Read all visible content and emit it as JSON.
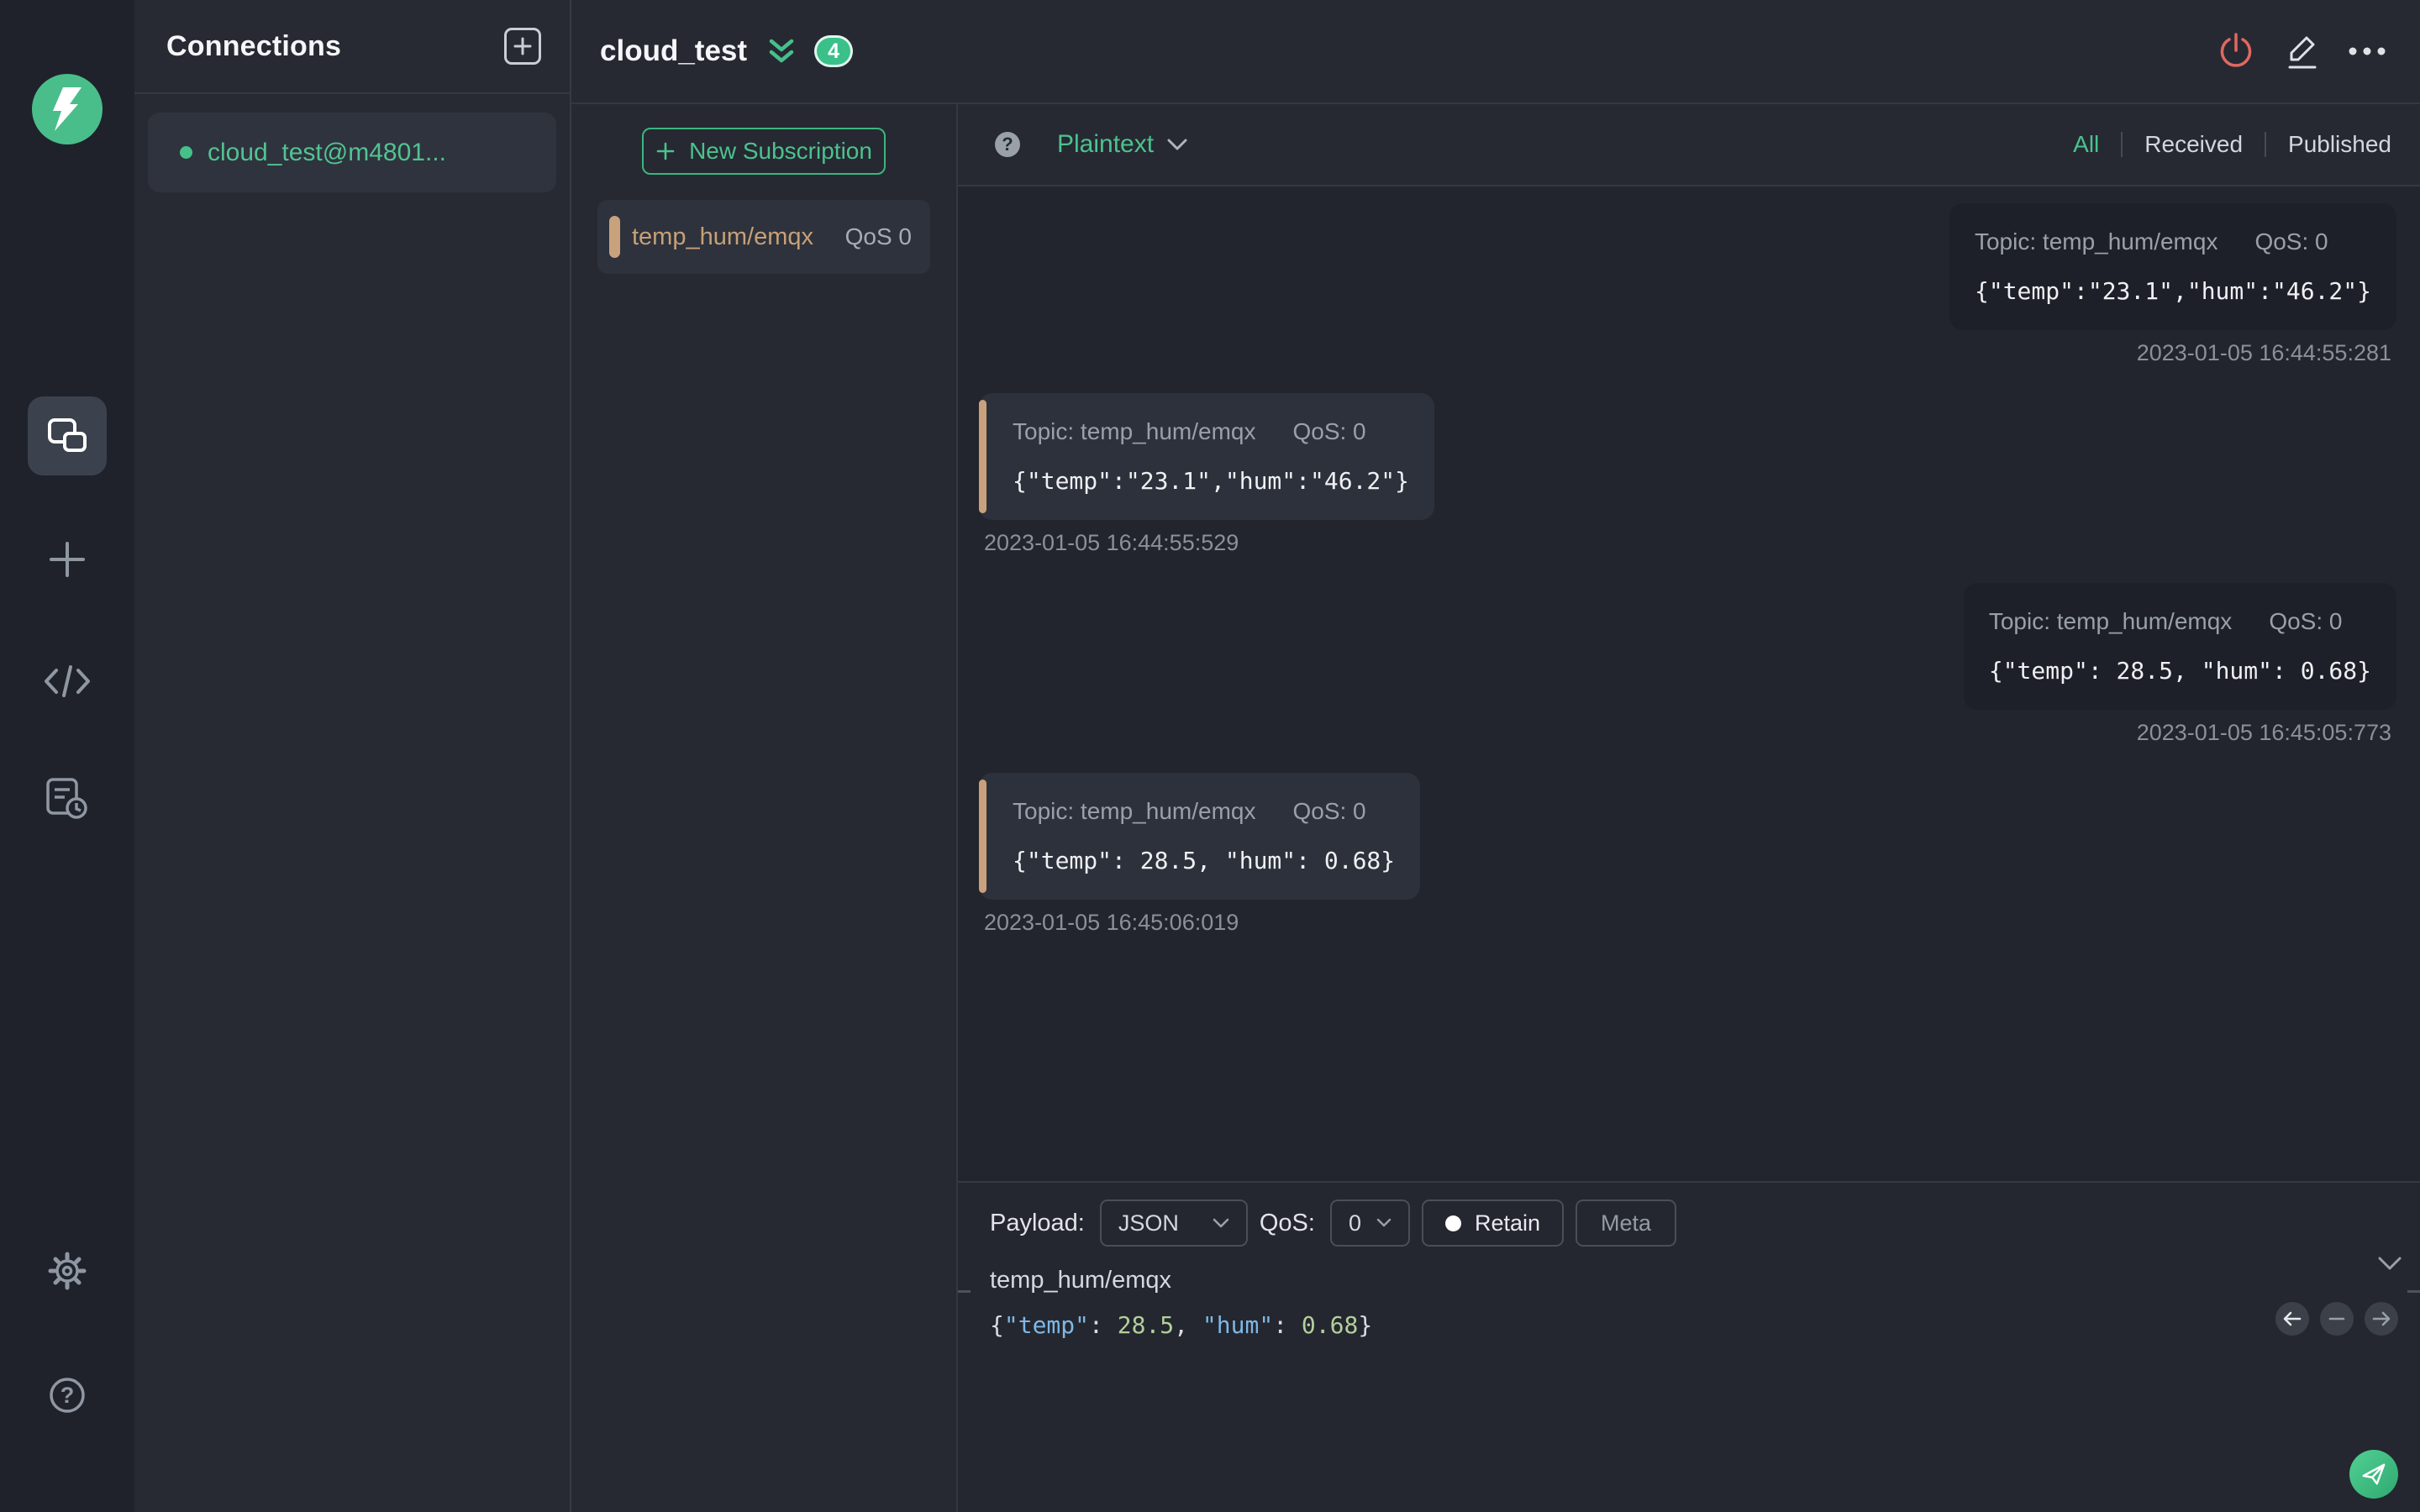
{
  "colors": {
    "accent_green": "#46c08a",
    "topic_tan": "#c9a27d",
    "danger_red": "#e0695f",
    "connected_dot": "#45c08a"
  },
  "connections_panel": {
    "title": "Connections",
    "items": [
      {
        "name": "cloud_test@m4801...",
        "status": "connected"
      }
    ]
  },
  "header": {
    "title": "cloud_test",
    "unread_badge": "4"
  },
  "filter_bar": {
    "format_selected": "Plaintext",
    "help_glyph": "?",
    "tabs": [
      {
        "label": "All",
        "active": true
      },
      {
        "label": "Received",
        "active": false
      },
      {
        "label": "Published",
        "active": false
      }
    ]
  },
  "subscriptions": {
    "new_button_label": "New Subscription",
    "items": [
      {
        "topic": "temp_hum/emqx",
        "qos": "QoS 0"
      }
    ]
  },
  "messages": [
    {
      "direction": "published",
      "topic": "Topic: temp_hum/emqx",
      "qos": "QoS: 0",
      "payload": "{\"temp\":\"23.1\",\"hum\":\"46.2\"}",
      "timestamp": "2023-01-05 16:44:55:281"
    },
    {
      "direction": "received",
      "topic": "Topic: temp_hum/emqx",
      "qos": "QoS: 0",
      "payload": "{\"temp\":\"23.1\",\"hum\":\"46.2\"}",
      "timestamp": "2023-01-05 16:44:55:529"
    },
    {
      "direction": "published",
      "topic": "Topic: temp_hum/emqx",
      "qos": "QoS: 0",
      "payload": "{\"temp\": 28.5, \"hum\": 0.68}",
      "timestamp": "2023-01-05 16:45:05:773"
    },
    {
      "direction": "received",
      "topic": "Topic: temp_hum/emqx",
      "qos": "QoS: 0",
      "payload": "{\"temp\": 28.5, \"hum\": 0.68}",
      "timestamp": "2023-01-05 16:45:06:019"
    }
  ],
  "publish": {
    "payload_label": "Payload:",
    "payload_format": "JSON",
    "qos_label": "QoS:",
    "qos_value": "0",
    "retain_label": "Retain",
    "meta_label": "Meta",
    "topic": "temp_hum/emqx",
    "payload_tokens": [
      {
        "text": "{",
        "type": "punct"
      },
      {
        "text": "\"temp\"",
        "type": "key"
      },
      {
        "text": ": ",
        "type": "punct"
      },
      {
        "text": "28.5",
        "type": "number"
      },
      {
        "text": ", ",
        "type": "punct"
      },
      {
        "text": "\"hum\"",
        "type": "key"
      },
      {
        "text": ": ",
        "type": "punct"
      },
      {
        "text": "0.68",
        "type": "number"
      },
      {
        "text": "}",
        "type": "punct"
      }
    ]
  },
  "icons": {
    "app_logo": "mqttx-bolt",
    "new_connection": "plus-square",
    "connections": "overlapping-squares",
    "script": "code-brackets",
    "log": "document-clock",
    "settings": "gear",
    "help": "question-circle",
    "disconnect": "power",
    "edit": "pencil",
    "more": "ellipsis",
    "collapse_all": "double-chevron-down",
    "send": "paper-plane",
    "history_prev": "arrow-left",
    "history_clear": "minus",
    "history_next": "arrow-right"
  }
}
